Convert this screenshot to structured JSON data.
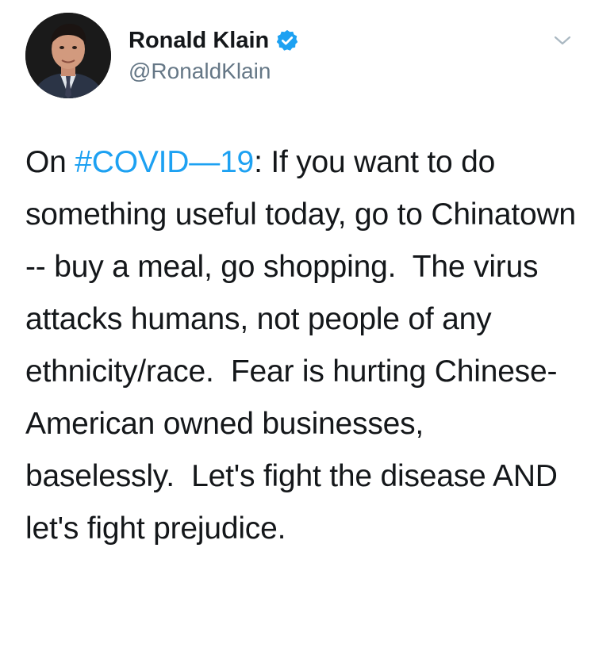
{
  "tweet": {
    "author": {
      "display_name": "Ronald Klain",
      "handle": "@RonaldKlain",
      "verified": true,
      "verified_color": "#1da1f2"
    },
    "text_prefix": "On ",
    "hashtag": "#COVID—19",
    "hashtag_color": "#1da1f2",
    "text_body": ": If you want to do something useful today, go to Chinatown -- buy a meal, go shopping.  The virus attacks humans, not people of any ethnicity/race.  Fear is hurting Chinese-American owned businesses, baselessly.  Let's fight the disease AND let's fight prejudice.",
    "menu_icon": "chevron-down-icon"
  }
}
